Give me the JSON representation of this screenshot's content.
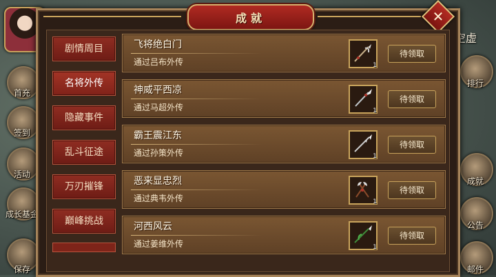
{
  "hud": {
    "right_top": "空虚",
    "left_icons": [
      {
        "label": "首充",
        "icon": "gift-icon"
      },
      {
        "label": "签到",
        "icon": "calendar-icon"
      },
      {
        "label": "活动",
        "icon": "event-icon"
      },
      {
        "label": "成长基金",
        "icon": "fund-icon"
      },
      {
        "label": "保存",
        "icon": "save-icon"
      }
    ],
    "right_icons": [
      {
        "label": "排行",
        "icon": "ranking-icon"
      },
      {
        "label": "成就",
        "icon": "achievement-icon"
      },
      {
        "label": "公告",
        "icon": "notice-icon"
      },
      {
        "label": "邮件",
        "icon": "mail-icon"
      }
    ]
  },
  "dialog": {
    "title": "成就",
    "close": "✕"
  },
  "tabs": [
    {
      "label": "剧情周目"
    },
    {
      "label": "名将外传",
      "active": true
    },
    {
      "label": "隐藏事件"
    },
    {
      "label": "乱斗征途"
    },
    {
      "label": "万刃摧锋"
    },
    {
      "label": "巅峰挑战"
    }
  ],
  "achievements": [
    {
      "title": "飞将绝白门",
      "desc": "通过吕布外传",
      "reward_icon": "halberd-icon",
      "count": "1",
      "button": "待领取"
    },
    {
      "title": "神威平西凉",
      "desc": "通过马超外传",
      "reward_icon": "spear-icon",
      "count": "1",
      "button": "待领取"
    },
    {
      "title": "霸王震江东",
      "desc": "通过孙策外传",
      "reward_icon": "spear-icon",
      "count": "1",
      "button": "待领取"
    },
    {
      "title": "恶来显忠烈",
      "desc": "通过典韦外传",
      "reward_icon": "twin-axe-icon",
      "count": "1",
      "button": "待领取"
    },
    {
      "title": "河西风云",
      "desc": "通过姜维外传",
      "reward_icon": "green-spear-icon",
      "count": "1",
      "button": "待领取"
    }
  ]
}
